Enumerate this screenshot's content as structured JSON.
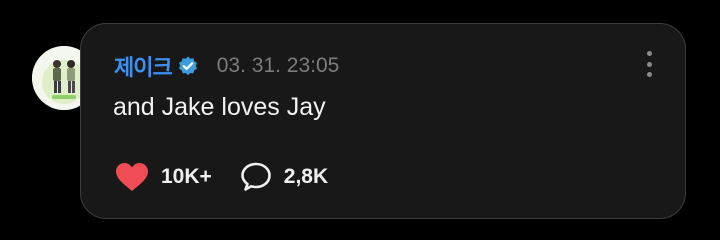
{
  "post": {
    "author": "제이크",
    "verified": true,
    "timestamp": "03. 31. 23:05",
    "text": "and Jake loves Jay",
    "likes": "10K+",
    "comments": "2,8K"
  },
  "icons": {
    "verified": "verified-badge-icon",
    "more": "more-vertical-icon",
    "like": "heart-icon",
    "comment": "comment-bubble-icon"
  },
  "colors": {
    "background": "#000000",
    "card": "#181818",
    "author": "#3d8ff2",
    "heart": "#ef4d53",
    "timestamp": "#7c7c7c"
  }
}
